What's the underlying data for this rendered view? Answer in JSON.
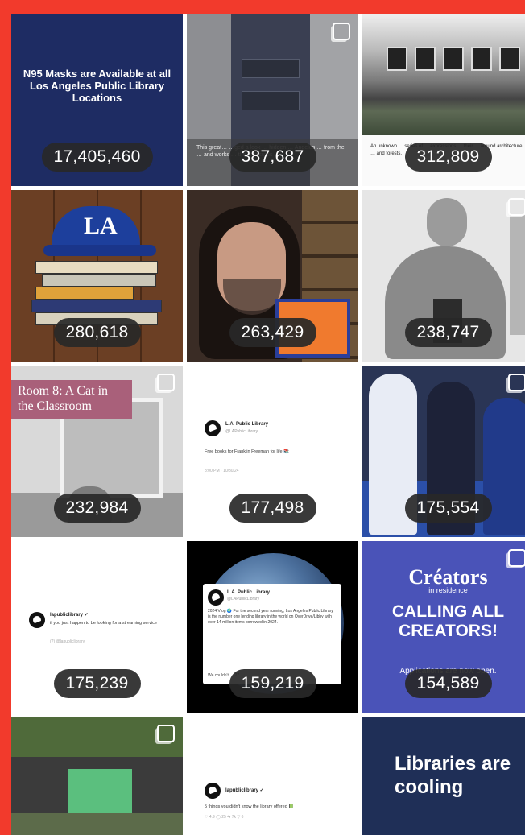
{
  "tiles": [
    {
      "count": "17,405,460",
      "text": "N95 Masks are Available at all Los Angeles Public Library Locations"
    },
    {
      "count": "387,687",
      "caption": "This great… …ged a look … hidden … Angeles … from the … and works … the Treasures"
    },
    {
      "count": "312,809",
      "caption": "An unknown … series of … expressions … their … around architecture … and forests."
    },
    {
      "count": "280,618",
      "text": "LA"
    },
    {
      "count": "263,429"
    },
    {
      "count": "238,747"
    },
    {
      "count": "232,984",
      "text": "Room 8: A Cat in the Classroom"
    },
    {
      "count": "177,498",
      "name": "L.A. Public Library",
      "handle": "@LAPublicLibrary",
      "text": "Free books for Franklin Freeman for life 📚",
      "meta": "8:00 PM · 10/30/24"
    },
    {
      "count": "175,554"
    },
    {
      "count": "175,239",
      "name": "lapubliclibrary ✓",
      "text": "if you just happen to be looking for a streaming service",
      "meta": "(?) @lapubliclibrary"
    },
    {
      "count": "159,219",
      "name": "L.A. Public Library",
      "handle": "@LAPublicLibrary",
      "text": "2024 Vlog 🌍 For the second year running, Los Angeles Public Library is the number one lending library in the world on OverDrive/Libby with over 14 million items borrowed in 2024.",
      "meta": "We couldn't …   27"
    },
    {
      "count": "154,589",
      "logo": "Créators",
      "sub": "in residence",
      "big": "CALLING ALL CREATORS!",
      "apps": "Applications are now open."
    },
    {
      "count": ""
    },
    {
      "count": "",
      "name": "lapubliclibrary ✓",
      "text": "5 things you didn't know the library offered 📗",
      "meta": "♡ 4.9   ◯ 25   ⇆ 7k   ▽ 6"
    },
    {
      "count": "",
      "text": "Libraries are cooling"
    }
  ]
}
